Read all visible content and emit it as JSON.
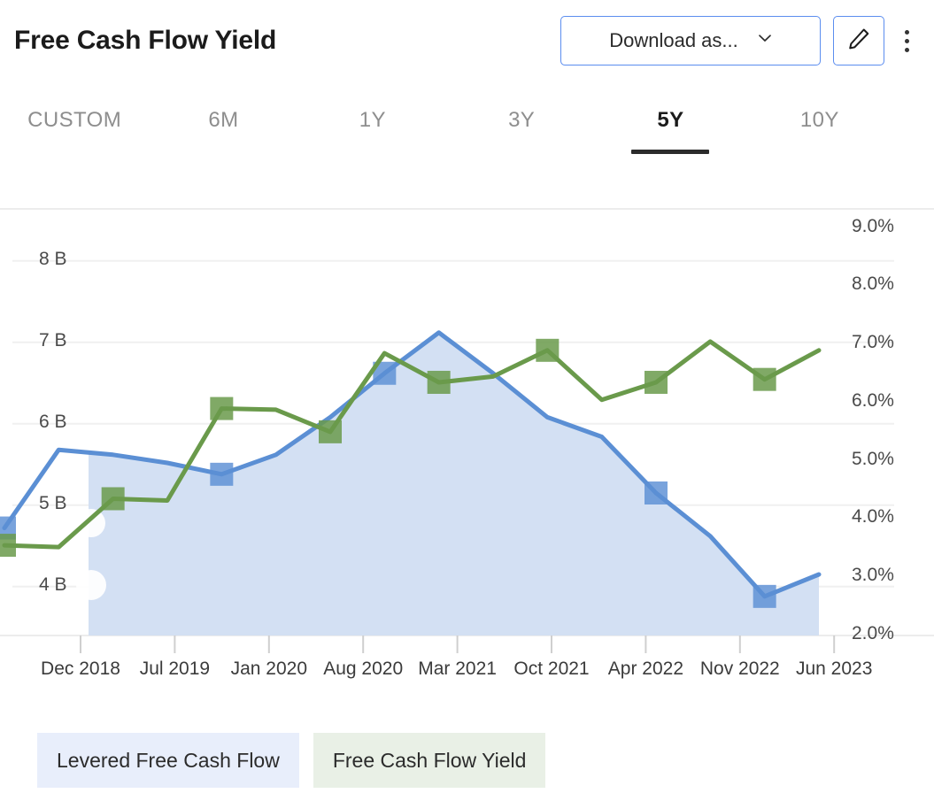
{
  "header": {
    "title": "Free Cash Flow Yield",
    "download_label": "Download as...",
    "download_icon": "chevron-down-icon",
    "edit_icon": "pencil-icon",
    "more_icon": "kebab-menu-icon"
  },
  "tabs": [
    {
      "label": "CUSTOM",
      "active": false
    },
    {
      "label": "6M",
      "active": false
    },
    {
      "label": "1Y",
      "active": false
    },
    {
      "label": "3Y",
      "active": false
    },
    {
      "label": "5Y",
      "active": true
    },
    {
      "label": "10Y",
      "active": false
    }
  ],
  "colors": {
    "series_lfcf_line": "#5b8fd4",
    "series_lfcf_fill": "#d3e0f3",
    "series_fcfy_line": "#6a9a4b",
    "accent_border": "#5b8def",
    "grid": "#f0f0f0",
    "axis_text": "#4a4a4a",
    "legend_lfcf_bg": "#e8eefb",
    "legend_fcfy_bg": "#e9f0e6"
  },
  "legend": [
    {
      "label": "Levered Free Cash Flow",
      "color": "#5b8fd4"
    },
    {
      "label": "Free Cash Flow Yield",
      "color": "#6a9a4b"
    }
  ],
  "chart_data": {
    "type": "line",
    "title": "Free Cash Flow Yield",
    "xlabel": "",
    "ylabel": "Levered Free Cash Flow",
    "y2label": "Free Cash Flow Yield",
    "grid": true,
    "legend_position": "bottom-left",
    "x_tick_labels": [
      "Dec 2018",
      "Jul 2019",
      "Jan 2020",
      "Aug 2020",
      "Mar 2021",
      "Oct 2021",
      "Apr 2022",
      "Nov 2022",
      "Jun 2023"
    ],
    "y_tick_labels": [
      "8 B",
      "7 B",
      "6 B",
      "5 B",
      "4 B"
    ],
    "y_tick_values": [
      8,
      7,
      6,
      5,
      4
    ],
    "ylim": [
      3.4,
      8.4
    ],
    "y2_tick_labels": [
      "9.0%",
      "8.0%",
      "7.0%",
      "6.0%",
      "5.0%",
      "4.0%",
      "3.0%",
      "2.0%"
    ],
    "y2_tick_values": [
      9,
      8,
      7,
      6,
      5,
      4,
      3,
      2
    ],
    "y2lim": [
      2.0,
      9.3
    ],
    "series": [
      {
        "name": "Levered Free Cash Flow",
        "axis": "left",
        "unit": "B",
        "type": "area",
        "color": "#5b8fd4",
        "fill": "#d3e0f3",
        "x": [
          "Dec 2018",
          "Mar 2019",
          "Jul 2019",
          "Oct 2019",
          "Jan 2020",
          "Apr 2020",
          "Aug 2020",
          "Nov 2020",
          "Mar 2021",
          "Jun 2021",
          "Oct 2021",
          "Jan 2022",
          "Apr 2022",
          "Aug 2022",
          "Nov 2022",
          "Jun 2023"
        ],
        "values": [
          4.72,
          5.68,
          5.62,
          5.52,
          5.38,
          5.62,
          6.08,
          6.62,
          7.12,
          6.62,
          6.08,
          5.84,
          5.15,
          4.62,
          3.88,
          4.15
        ],
        "markers_at": [
          "Dec 2018",
          "Jan 2020",
          "Nov 2020",
          "Apr 2022",
          "Nov 2022"
        ]
      },
      {
        "name": "Free Cash Flow Yield",
        "axis": "right",
        "unit": "%",
        "type": "line",
        "color": "#6a9a4b",
        "x": [
          "Dec 2018",
          "Mar 2019",
          "Jul 2019",
          "Oct 2019",
          "Jan 2020",
          "Apr 2020",
          "Aug 2020",
          "Nov 2020",
          "Mar 2021",
          "Jun 2021",
          "Oct 2021",
          "Jan 2022",
          "Apr 2022",
          "Aug 2022",
          "Nov 2022",
          "Jun 2023"
        ],
        "values": [
          3.55,
          3.52,
          4.35,
          4.32,
          5.9,
          5.88,
          5.5,
          6.85,
          6.35,
          6.45,
          6.9,
          6.05,
          6.35,
          7.05,
          6.4,
          6.9
        ],
        "markers_at": [
          "Dec 2018",
          "Jul 2019",
          "Jan 2020",
          "Aug 2020",
          "Mar 2021",
          "Oct 2021",
          "Apr 2022",
          "Nov 2022"
        ]
      }
    ]
  }
}
